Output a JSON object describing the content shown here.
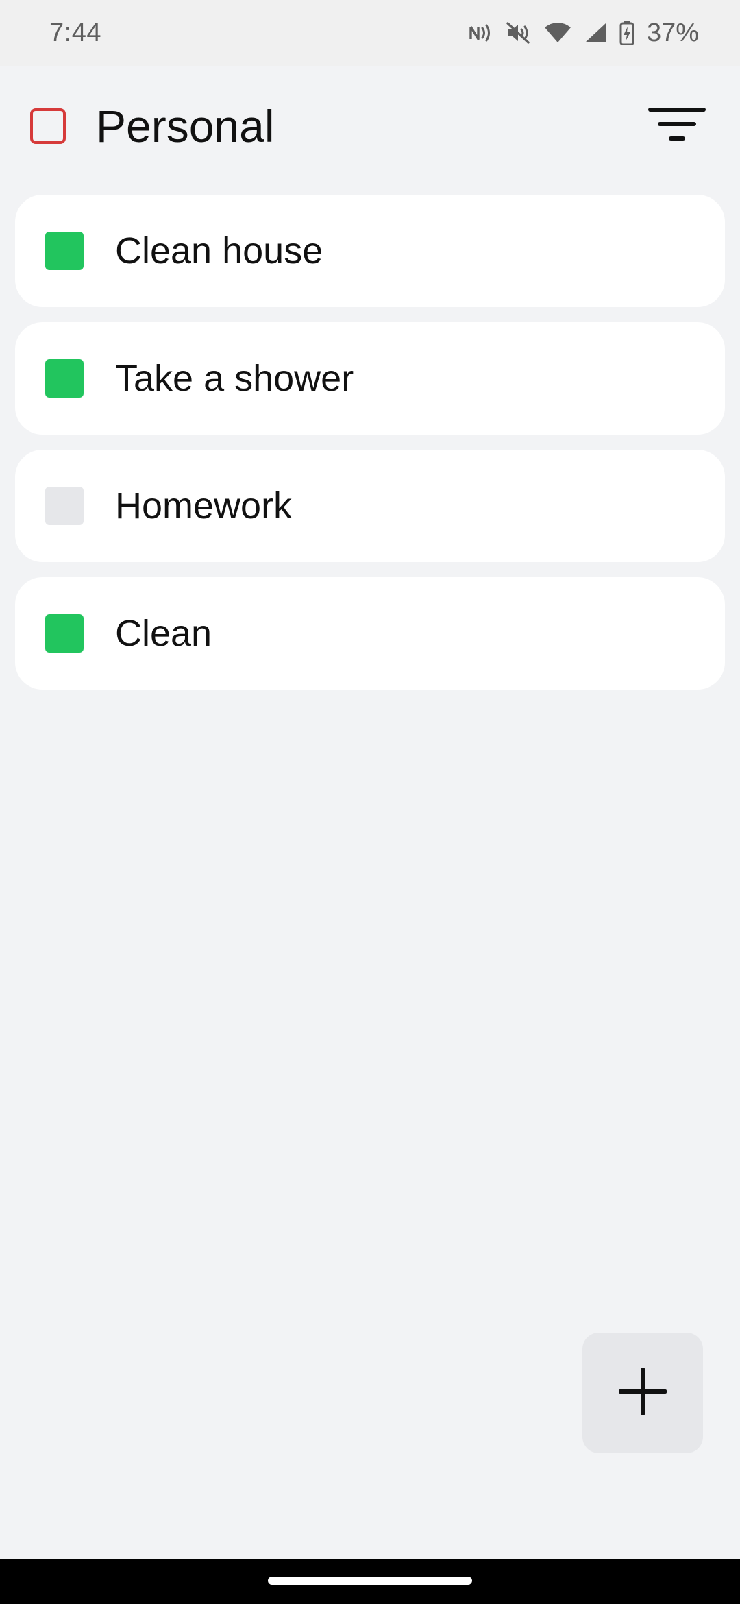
{
  "status_bar": {
    "time": "7:44",
    "battery_percent": "37%",
    "icons": [
      "nfc-icon",
      "mute-icon",
      "wifi-icon",
      "cell-signal-icon",
      "battery-charging-icon"
    ]
  },
  "header": {
    "title": "Personal",
    "list_color": "#d63a3a",
    "filter_icon": "filter-icon"
  },
  "tasks": [
    {
      "label": "Clean house",
      "completed": true
    },
    {
      "label": "Take a shower",
      "completed": true
    },
    {
      "label": "Homework",
      "completed": false
    },
    {
      "label": "Clean",
      "completed": true
    }
  ],
  "colors": {
    "completed": "#22c55e",
    "incomplete": "#e6e7ea",
    "background": "#f2f3f5",
    "card": "#ffffff"
  },
  "fab": {
    "icon": "plus-icon"
  }
}
